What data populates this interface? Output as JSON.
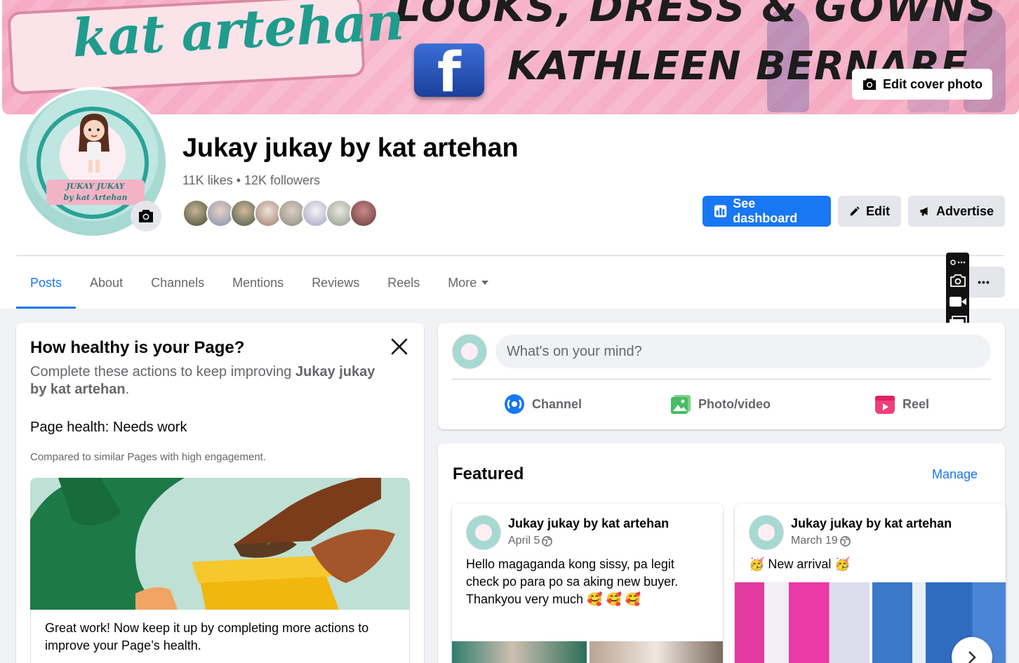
{
  "cover": {
    "banner_text": "LOOKS, DRESS & GOWNS",
    "brand_text": "kat artehan",
    "fb_letter": "f",
    "owner_text": "KATHLEEN BERNARE",
    "edit_label": "Edit cover photo"
  },
  "avatar": {
    "plate_line1": "JUKAY JUKAY",
    "plate_line2": "by kat Artehan"
  },
  "page": {
    "name": "Jukay jukay by kat artehan",
    "stats": "11K likes • 12K followers"
  },
  "actions": {
    "dashboard": "See dashboard",
    "edit": "Edit",
    "advertise": "Advertise"
  },
  "tabs": [
    {
      "label": "Posts"
    },
    {
      "label": "About"
    },
    {
      "label": "Channels"
    },
    {
      "label": "Mentions"
    },
    {
      "label": "Reviews"
    },
    {
      "label": "Reels"
    },
    {
      "label": "More"
    }
  ],
  "more_dots": "•••",
  "health": {
    "title": "How healthy is your Page?",
    "sub_prefix": "Complete these actions to keep improving ",
    "sub_name": "Jukay jukay by kat artehan",
    "sub_suffix": ".",
    "status": "Page health: Needs work",
    "compare": "Compared to similar Pages with high engagement.",
    "caption": "Great work! Now keep it up by completing more actions to improve your Page’s health."
  },
  "composer": {
    "placeholder": "What's on your mind?",
    "actions": [
      {
        "label": "Channel"
      },
      {
        "label": "Photo/video"
      },
      {
        "label": "Reel"
      }
    ]
  },
  "featured": {
    "title": "Featured",
    "manage": "Manage",
    "posts": [
      {
        "author": "Jukay jukay by kat artehan",
        "date": "April 5",
        "text": "Hello magaganda kong sissy, pa legit check po para po sa aking new buyer. Thankyou very much 🥰 🥰 🥰"
      },
      {
        "author": "Jukay jukay by kat artehan",
        "date": "March 19",
        "text": "🥳 New arrival 🥳"
      }
    ]
  },
  "colors": {
    "accent": "#1877f2",
    "text_secondary": "#65676b",
    "button_gray": "#e4e6eb"
  }
}
